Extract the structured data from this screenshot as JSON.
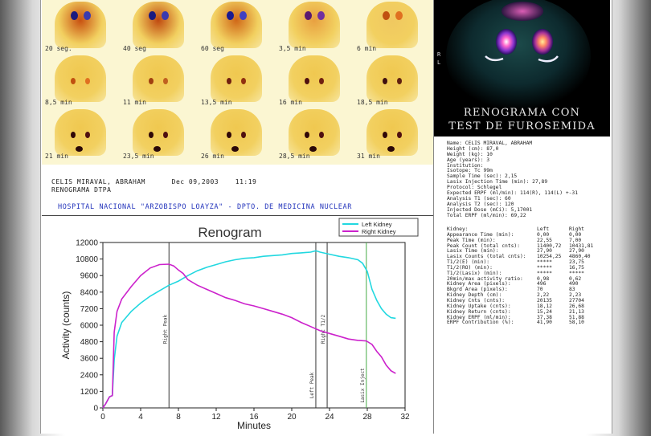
{
  "frames": [
    {
      "label": "20 seg."
    },
    {
      "label": "40 seg"
    },
    {
      "label": "60 seg"
    },
    {
      "label": "3,5 min"
    },
    {
      "label": "6 min"
    },
    {
      "label": "8,5 min"
    },
    {
      "label": "11 min"
    },
    {
      "label": "13,5 min"
    },
    {
      "label": "16 min"
    },
    {
      "label": "18,5 min"
    },
    {
      "label": "21 min"
    },
    {
      "label": "23,5 min"
    },
    {
      "label": "26 min"
    },
    {
      "label": "28,5 min"
    },
    {
      "label": "31 min"
    }
  ],
  "patient": {
    "name": "CELIS MIRAVAL, ABRAHAM",
    "date": "Dec 09,2003",
    "time": "11:19",
    "study": "RENOGRAMA DTPA"
  },
  "hospital": "HOSPITAL NACIONAL \"ARZOBISPO LOAYZA\" - DPTO. DE MEDICINA NUCLEAR",
  "panel_title": [
    "RENOGRAMA CON",
    "TEST DE FUROSEMIDA"
  ],
  "side_labels": {
    "right": "R",
    "left": "L"
  },
  "demographics": [
    "Name: CELIS MIRAVAL, ABRAHAM",
    "Height (cm): 87,0",
    "Weight (kg): 10",
    "Age (years): 3",
    "Institution:",
    "Isotope: Tc 99m",
    "Sample Time (sec): 2,15",
    "Lasix Injection Time (min): 27,89",
    "Protocol: Schlegel",
    "Expected ERPF (ml/min): 114(R), 114(L) +-31",
    "Analysis T1 (sec): 60",
    "Analysis T2 (sec): 120",
    "Injected Dose (mCi): 5,17001",
    "Total ERPF (ml/min): 69,22"
  ],
  "table": {
    "headers": [
      "Kidney:",
      "Left",
      "Right"
    ],
    "rows": [
      [
        "Appearance Time (min):",
        "0,00",
        "0,00"
      ],
      [
        "Peak Time (min):",
        "22,55",
        "7,00"
      ],
      [
        "Peak Count (total cnts):",
        "11400,72",
        "10431,81"
      ],
      [
        "Lasix Time (min):",
        "27,90",
        "27,90"
      ],
      [
        "Lasix Counts (total cnts):",
        "10254,25",
        "4860,40"
      ],
      [
        "T1/2(E) (min):",
        "*****",
        "23,75"
      ],
      [
        "T1/2(RO) (min):",
        "*****",
        "16,75"
      ],
      [
        "T1/2(Lasix) (min):",
        "*****",
        "*****"
      ],
      [
        "20min/max activity ratio:",
        "0,98",
        "0,62"
      ],
      [
        "Kidney Area (pixels):",
        "496",
        "490"
      ],
      [
        "Bkgrd Area (pixels):",
        "70",
        "83"
      ],
      [
        "Kidney Depth (cm):",
        "2,22",
        "2,23"
      ],
      [
        "Kidney Cnts (cnts):",
        "20135",
        "27704"
      ],
      [
        "Kidney Uptake (cnts):",
        "18,12",
        "26,68"
      ],
      [
        "Kidney Return (cnts):",
        "15,24",
        "21,13"
      ],
      [
        "Kidney ERPF (ml/min):",
        "37,38",
        "51,88"
      ],
      [
        "ERPF Contribution (%):",
        "41,90",
        "58,10"
      ]
    ]
  },
  "chart_data": {
    "type": "line",
    "title": "Renogram",
    "xlabel": "Minutes",
    "ylabel": "Activity (counts)",
    "xlim": [
      0,
      32
    ],
    "ylim": [
      0,
      12000
    ],
    "xticks": [
      0,
      4,
      8,
      12,
      16,
      20,
      24,
      28,
      32
    ],
    "yticks": [
      0,
      1200,
      2400,
      3600,
      4800,
      6000,
      7200,
      8400,
      9600,
      10800,
      12000
    ],
    "legend_position": "top-right",
    "series": [
      {
        "name": "Left Kidney",
        "color": "#22d8e0",
        "x": [
          0,
          0.3,
          0.7,
          1.0,
          1.2,
          1.5,
          2,
          3,
          4,
          5,
          6,
          7,
          8,
          9,
          10,
          11,
          12,
          13,
          14,
          15,
          16,
          17,
          18,
          19,
          20,
          21,
          22,
          22.55,
          23,
          24,
          25,
          26,
          27,
          27.5,
          28,
          28.5,
          29,
          29.5,
          30,
          30.5,
          31
        ],
        "y": [
          0,
          300,
          800,
          900,
          3500,
          5200,
          6200,
          7000,
          7600,
          8100,
          8500,
          8900,
          9200,
          9600,
          9950,
          10200,
          10400,
          10600,
          10750,
          10850,
          10900,
          11000,
          11050,
          11100,
          11200,
          11250,
          11300,
          11400,
          11300,
          11150,
          11000,
          10900,
          10750,
          10500,
          9900,
          8600,
          7800,
          7200,
          6800,
          6550,
          6500
        ]
      },
      {
        "name": "Right Kidney",
        "color": "#cc22cc",
        "x": [
          0,
          0.3,
          0.7,
          1.0,
          1.2,
          1.5,
          2,
          3,
          4,
          5,
          6,
          7,
          7.5,
          8,
          8.5,
          9,
          10,
          11,
          12,
          13,
          14,
          15,
          16,
          17,
          18,
          19,
          20,
          21,
          22,
          23,
          24,
          25,
          26,
          27,
          27.9,
          28.5,
          29,
          29.5,
          30,
          30.5,
          31
        ],
        "y": [
          0,
          300,
          800,
          900,
          5500,
          7000,
          7900,
          8800,
          9600,
          10150,
          10400,
          10430,
          10300,
          10000,
          9750,
          9300,
          8900,
          8600,
          8300,
          8000,
          7800,
          7550,
          7400,
          7200,
          7000,
          6800,
          6550,
          6200,
          5900,
          5600,
          5400,
          5200,
          5000,
          4900,
          4860,
          4600,
          4100,
          3700,
          3100,
          2700,
          2500
        ]
      }
    ],
    "markers": [
      {
        "x": 7.0,
        "label": "Right Peak",
        "color": "#333333"
      },
      {
        "x": 22.55,
        "label": "Left Peak",
        "color": "#333333"
      },
      {
        "x": 23.75,
        "label": "Right T1/2",
        "color": "#333333"
      },
      {
        "x": 27.9,
        "label": "Lasix Inject",
        "color": "#44aa44"
      }
    ]
  }
}
